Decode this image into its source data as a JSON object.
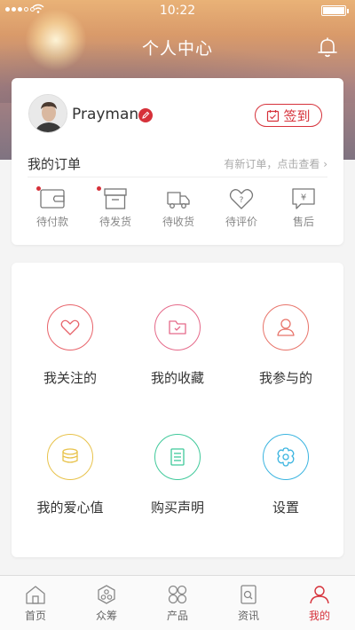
{
  "status": {
    "time": "10:22",
    "battery_level": 1.0
  },
  "header": {
    "title": "个人中心"
  },
  "profile": {
    "username": "Prayman",
    "checkin_label": "签到"
  },
  "orders": {
    "title": "我的订单",
    "hint": "有新订单，点击查看 ›",
    "items": [
      {
        "label": "待付款",
        "icon": "wallet-icon",
        "badge": true
      },
      {
        "label": "待发货",
        "icon": "package-icon",
        "badge": true
      },
      {
        "label": "待收货",
        "icon": "truck-icon",
        "badge": false
      },
      {
        "label": "待评价",
        "icon": "comment-heart-icon",
        "badge": false
      },
      {
        "label": "售后",
        "icon": "yen-icon",
        "badge": false
      }
    ]
  },
  "menu": {
    "items": [
      {
        "label": "我关注的",
        "icon": "heart-icon",
        "color": "#e8636a"
      },
      {
        "label": "我的收藏",
        "icon": "folder-icon",
        "color": "#e56a8a"
      },
      {
        "label": "我参与的",
        "icon": "user-icon",
        "color": "#e8746a"
      },
      {
        "label": "我的爱心值",
        "icon": "coins-icon",
        "color": "#e8c24a"
      },
      {
        "label": "购买声明",
        "icon": "document-icon",
        "color": "#3fc99a"
      },
      {
        "label": "设置",
        "icon": "flower-gear-icon",
        "color": "#3ab4e0"
      }
    ]
  },
  "tabbar": {
    "active_index": 4,
    "active_color": "#d6313a",
    "items": [
      {
        "label": "首页",
        "icon": "home-icon"
      },
      {
        "label": "众筹",
        "icon": "crowdfund-icon"
      },
      {
        "label": "产品",
        "icon": "grid-icon"
      },
      {
        "label": "资讯",
        "icon": "news-icon"
      },
      {
        "label": "我的",
        "icon": "profile-icon"
      }
    ]
  }
}
